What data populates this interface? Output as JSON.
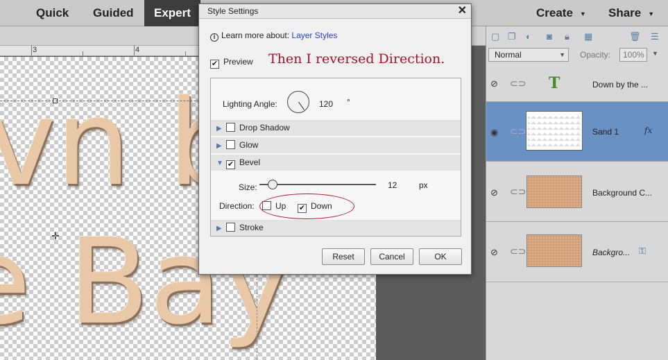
{
  "topbar": {
    "modes": [
      "Quick",
      "Guided",
      "Expert"
    ],
    "create": "Create",
    "share": "Share"
  },
  "ruler": {
    "ticks": [
      "3",
      "4"
    ]
  },
  "canvas_text": {
    "line1": "vn b",
    "line2": "e Bay"
  },
  "layers_panel": {
    "blend_mode": "Normal",
    "opacity_label": "Opacity:",
    "opacity_value": "100%",
    "layers": [
      {
        "name": "Down by the ...",
        "type": "text",
        "visible": false
      },
      {
        "name": "Sand 1",
        "type": "thumb-transparent",
        "visible": true,
        "selected": true,
        "fx": "fx"
      },
      {
        "name": "Background C...",
        "type": "thumb",
        "visible": false
      },
      {
        "name": "Backgro...",
        "type": "thumb",
        "visible": false,
        "italic": true
      }
    ]
  },
  "dialog": {
    "title": "Style Settings",
    "learn_prefix": "Learn more about:",
    "learn_link": "Layer Styles",
    "preview_label": "Preview",
    "annotation": "Then I reversed Direction.",
    "lighting_label": "Lighting Angle:",
    "lighting_value": "120",
    "degree": "°",
    "sections": [
      {
        "label": "Drop Shadow",
        "checked": false,
        "expanded": false
      },
      {
        "label": "Glow",
        "checked": false,
        "expanded": false
      },
      {
        "label": "Bevel",
        "checked": true,
        "expanded": true
      },
      {
        "label": "Stroke",
        "checked": false,
        "expanded": false
      }
    ],
    "size_label": "Size:",
    "size_value": "12",
    "size_unit": "px",
    "direction_label": "Direction:",
    "up_label": "Up",
    "down_label": "Down",
    "up_checked": false,
    "down_checked": true,
    "buttons": {
      "reset": "Reset",
      "cancel": "Cancel",
      "ok": "OK"
    }
  }
}
